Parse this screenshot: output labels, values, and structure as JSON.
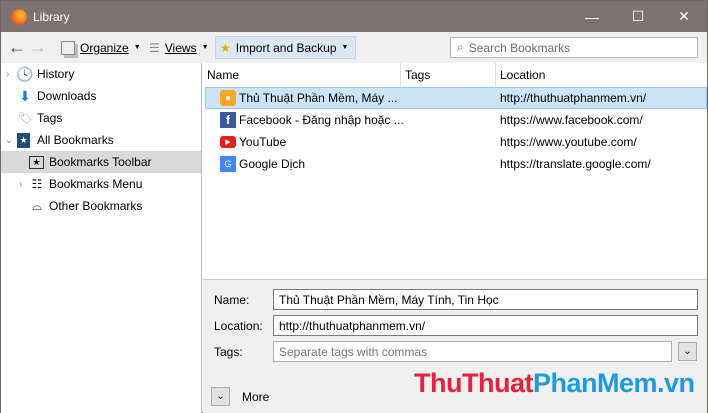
{
  "window": {
    "title": "Library",
    "minimize": "—",
    "maximize": "☐",
    "close": "✕"
  },
  "toolbar": {
    "back": "←",
    "forward": "→",
    "organize": "Organize",
    "views": "Views",
    "import_backup": "Import and Backup",
    "search_placeholder": "Search Bookmarks"
  },
  "sidebar": {
    "items": [
      {
        "label": "History",
        "icon": "clock-icon"
      },
      {
        "label": "Downloads",
        "icon": "download-arrow-icon"
      },
      {
        "label": "Tags",
        "icon": "tag-icon"
      },
      {
        "label": "All Bookmarks",
        "icon": "bookmarks-icon"
      },
      {
        "label": "Bookmarks Toolbar",
        "icon": "star-folder-icon"
      },
      {
        "label": "Bookmarks Menu",
        "icon": "menu-list-icon"
      },
      {
        "label": "Other Bookmarks",
        "icon": "tray-icon"
      }
    ]
  },
  "list": {
    "columns": [
      "Name",
      "Tags",
      "Location"
    ],
    "rows": [
      {
        "name": "Thủ Thuật Phần Mềm, Máy ...",
        "tags": "",
        "location": "http://thuthuatphanmem.vn/"
      },
      {
        "name": "Facebook - Đăng nhập hoặc ...",
        "tags": "",
        "location": "https://www.facebook.com/"
      },
      {
        "name": "YouTube",
        "tags": "",
        "location": "https://www.youtube.com/"
      },
      {
        "name": "Google Dịch",
        "tags": "",
        "location": "https://translate.google.com/"
      }
    ]
  },
  "details": {
    "name_label": "Name:",
    "name_value": "Thủ Thuật Phần Mềm, Máy Tính, Tin Học",
    "location_label": "Location:",
    "location_value": "http://thuthuatphanmem.vn/",
    "tags_label": "Tags:",
    "tags_placeholder": "Separate tags with commas",
    "more": "More"
  },
  "watermark": {
    "part1": "ThuThuat",
    "part2": "PhanMem",
    "part3": ".vn"
  },
  "colors": {
    "titlebar": "#7a7372",
    "selection": "#cce4f7",
    "watermark_red": "#e8203a",
    "watermark_blue": "#1e9be0"
  }
}
